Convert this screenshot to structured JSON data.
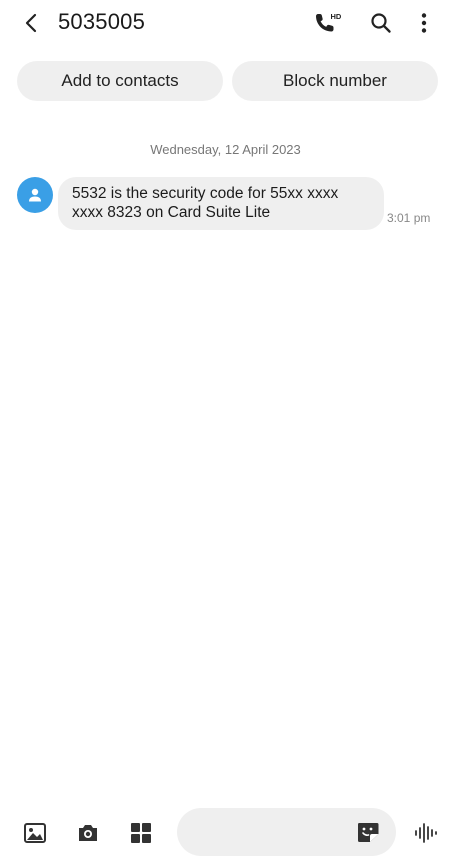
{
  "header": {
    "title": "5035005",
    "icons": {
      "back": "back-arrow-icon",
      "call": "hd-voice-call-icon",
      "hd_badge": "HD",
      "search": "search-icon",
      "more": "more-options-icon"
    }
  },
  "actions": {
    "add_contact_label": "Add to contacts",
    "block_number_label": "Block number"
  },
  "conversation": {
    "date": "Wednesday, 12 April 2023",
    "messages": [
      {
        "direction": "incoming",
        "text": "5532 is the security code for 55xx xxxx xxxx 8323 on Card Suite Lite",
        "time": "3:01 pm"
      }
    ]
  },
  "composer": {
    "placeholder": "",
    "value": "",
    "icons": [
      "gallery-icon",
      "camera-icon",
      "apps-icon",
      "sticker-icon",
      "voice-input-icon"
    ]
  },
  "colors": {
    "avatar": "#3a9fe6",
    "bubble": "#efefef",
    "pill": "#efefef",
    "text": "#1c1c1c",
    "muted": "#777777"
  }
}
